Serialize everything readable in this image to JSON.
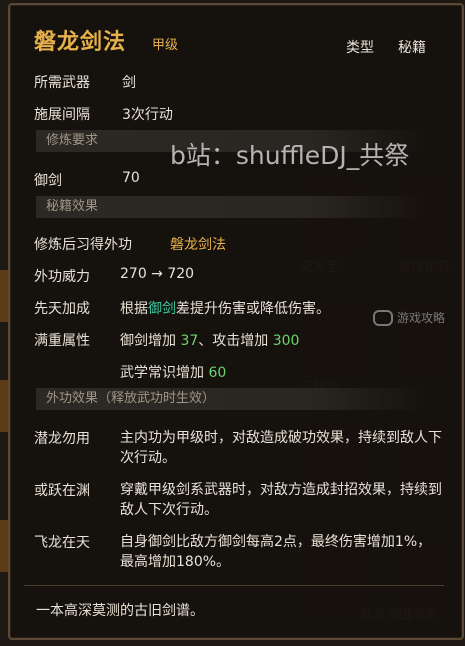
{
  "item": {
    "name": "磐龙剑法",
    "grade": "甲级",
    "type_label": "类型",
    "type_value": "秘籍"
  },
  "requirements": {
    "weapon_label": "所需武器",
    "weapon_value": "剑",
    "interval_label": "施展间隔",
    "interval_value": "3次行动"
  },
  "section_train": "修炼要求",
  "train": {
    "label": "御剑",
    "value": "70"
  },
  "section_effect": "秘籍效果",
  "learned": {
    "label": "修炼后习得外功",
    "value": "磐龙剑法"
  },
  "power": {
    "label": "外功威力",
    "value": "270 → 720"
  },
  "innate": {
    "label": "先天加成",
    "prefix": "根据",
    "highlight": "御剑",
    "suffix": "差提升伤害或降低伤害。"
  },
  "full": {
    "label": "满重属性",
    "line1_a": "御剑增加",
    "line1_a_val": "37",
    "line1_b": "、攻击增加",
    "line1_b_val": "300",
    "line2": "武学常识增加",
    "line2_val": "60"
  },
  "section_skill": "外功效果（释放武功时生效）",
  "effects": [
    {
      "name": "潜龙勿用",
      "text": "主内功为甲级时，对敌造成破功效果，持续到敌人下次行动。"
    },
    {
      "name": "或跃在渊",
      "text": "穿戴甲级剑系武器时，对敌方造成封招效果，持续到敌人下次行动。"
    },
    {
      "name": "飞龙在天",
      "text": "自身御剑比敌方御剑每高2点，最终伤害增加1%，最高增加180%。"
    }
  ],
  "flavor": "一本高深莫测的古旧剑谱。",
  "watermark": "b站：shuffleDJ_共祭",
  "watermark2": "游戏攻略",
  "bg_labels": [
    "天天宝",
    "紫霞秘籍",
    "三昧录",
    "山河录",
    "武学常识"
  ]
}
